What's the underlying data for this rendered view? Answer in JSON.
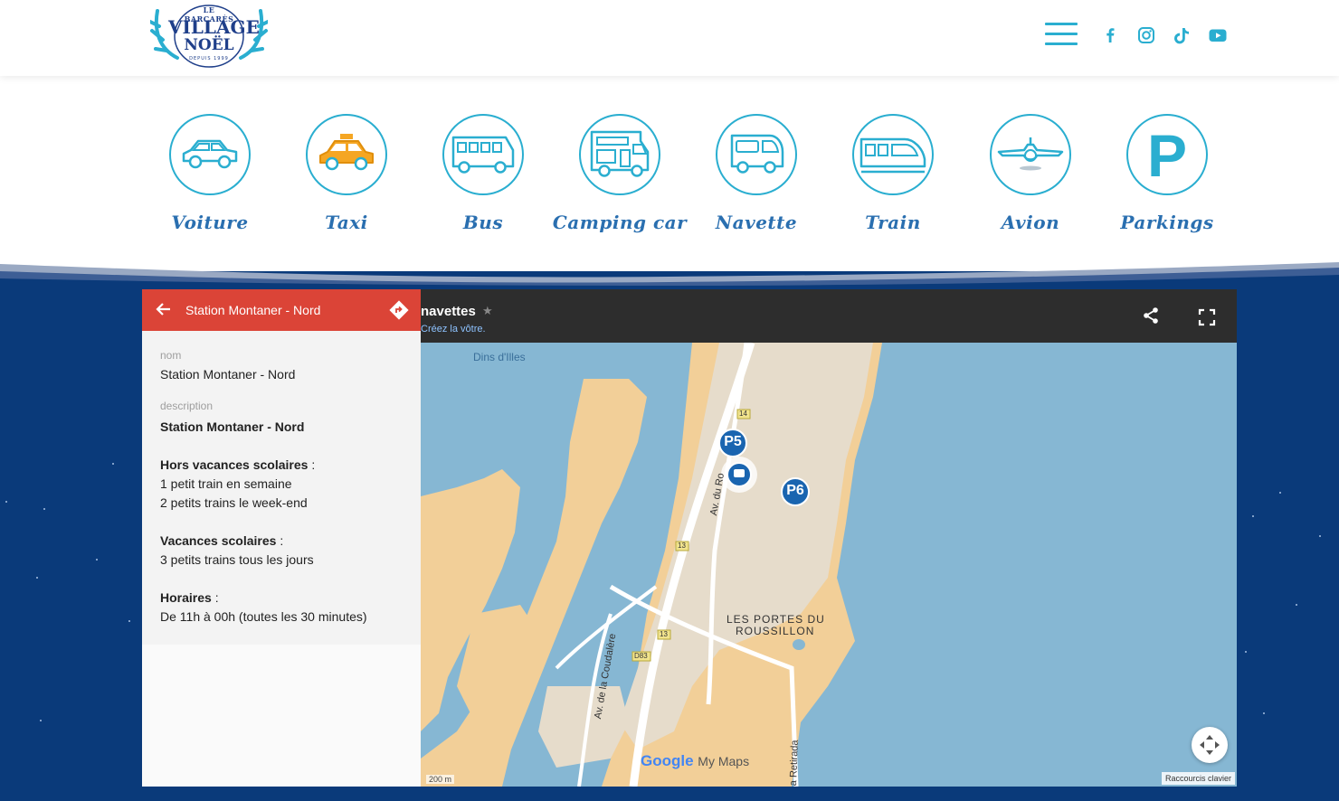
{
  "header": {
    "logo": {
      "line1": "LE BARCARÈS",
      "line2": "VILLAGE",
      "line3": "NOËL",
      "line4": "DEPUIS 1999"
    },
    "social": [
      "facebook-icon",
      "instagram-icon",
      "tiktok-icon",
      "youtube-icon"
    ]
  },
  "transport": [
    {
      "label": "Voiture",
      "icon": "car-icon"
    },
    {
      "label": "Taxi",
      "icon": "taxi-icon"
    },
    {
      "label": "Bus",
      "icon": "bus-icon"
    },
    {
      "label": "Camping car",
      "icon": "camper-icon"
    },
    {
      "label": "Navette",
      "icon": "shuttle-icon"
    },
    {
      "label": "Train",
      "icon": "train-icon"
    },
    {
      "label": "Avion",
      "icon": "plane-icon"
    },
    {
      "label": "Parkings",
      "icon": "parking-icon"
    }
  ],
  "map": {
    "title": "navettes",
    "subtitle": "Créez la vôtre.",
    "labels": {
      "dins": "Dins d'Illes",
      "portes1": "LES PORTES DU",
      "portes2": "ROUSSILLON",
      "road_ro": "Av. du Ro",
      "road_coudalere": "Av. de la Coudalère",
      "road_retirada": "a Retirada",
      "r14": "14",
      "r13a": "13",
      "r13b": "13",
      "d83": "D83"
    },
    "parking_markers": [
      "P5",
      "P6"
    ],
    "branding": {
      "google": "Google",
      "mymaps": "My Maps"
    },
    "scale": "200 m",
    "keyboard_shortcuts": "Raccourcis clavier"
  },
  "panel": {
    "title": "Station Montaner - Nord",
    "name_label": "nom",
    "name_value": "Station Montaner - Nord",
    "description_label": "description",
    "desc_title": "Station Montaner - Nord",
    "hors_title": "Hors vacances scolaires",
    "hors_line1": "1 petit train en semaine",
    "hors_line2": "2 petits trains le week-end",
    "vac_title": "Vacances scolaires",
    "vac_line1": "3 petits trains tous les jours",
    "horaires_title": "Horaires",
    "horaires_line1": "De 11h à 00h (toutes les 30 minutes)",
    "colon": " :"
  },
  "colors": {
    "accent": "#2aaed0",
    "label": "#2a6fb0",
    "night": "#0a3a7a",
    "panel_header": "#db4437",
    "land": "#f2cf98",
    "urban": "#e6dccb",
    "water": "#86b7d3"
  }
}
